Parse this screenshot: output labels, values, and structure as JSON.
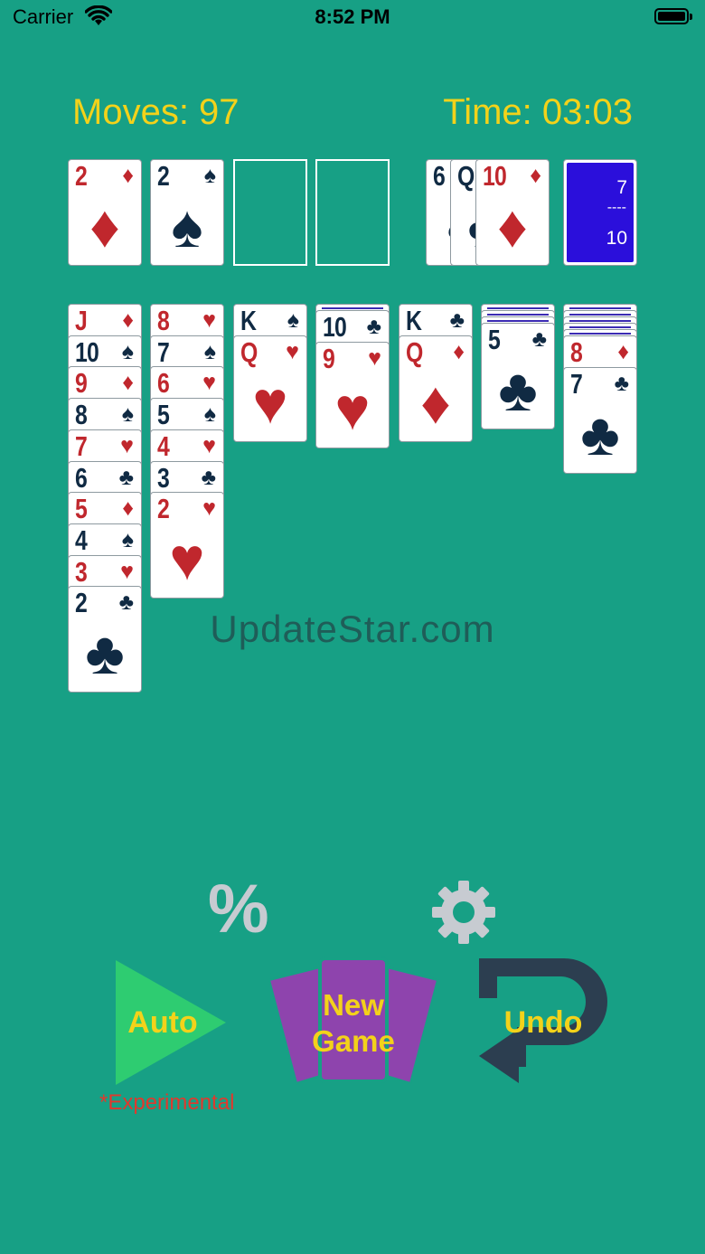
{
  "status_bar": {
    "carrier": "Carrier",
    "time": "8:52 PM"
  },
  "hud": {
    "moves": "Moves: 97",
    "time": "Time: 03:03"
  },
  "foundations": [
    {
      "rank": "2",
      "suit": "♦",
      "color": "red"
    },
    {
      "rank": "2",
      "suit": "♠",
      "color": "blk"
    },
    null,
    null
  ],
  "waste": [
    {
      "rank": "6",
      "suit": "♠",
      "color": "blk"
    },
    {
      "rank": "Q",
      "suit": "♣",
      "color": "blk"
    },
    {
      "rank": "10",
      "suit": "♦",
      "color": "red"
    }
  ],
  "stock": {
    "top": "7",
    "divider": "----",
    "bottom": "10"
  },
  "tableau": [
    {
      "hidden": 0,
      "cards": [
        {
          "rank": "J",
          "suit": "♦",
          "color": "red"
        },
        {
          "rank": "10",
          "suit": "♠",
          "color": "blk"
        },
        {
          "rank": "9",
          "suit": "♦",
          "color": "red"
        },
        {
          "rank": "8",
          "suit": "♠",
          "color": "blk"
        },
        {
          "rank": "7",
          "suit": "♥",
          "color": "red"
        },
        {
          "rank": "6",
          "suit": "♣",
          "color": "blk"
        },
        {
          "rank": "5",
          "suit": "♦",
          "color": "red"
        },
        {
          "rank": "4",
          "suit": "♠",
          "color": "blk"
        },
        {
          "rank": "3",
          "suit": "♥",
          "color": "red"
        },
        {
          "rank": "2",
          "suit": "♣",
          "color": "blk"
        }
      ]
    },
    {
      "hidden": 0,
      "cards": [
        {
          "rank": "8",
          "suit": "♥",
          "color": "red"
        },
        {
          "rank": "7",
          "suit": "♠",
          "color": "blk"
        },
        {
          "rank": "6",
          "suit": "♥",
          "color": "red"
        },
        {
          "rank": "5",
          "suit": "♠",
          "color": "blk"
        },
        {
          "rank": "4",
          "suit": "♥",
          "color": "red"
        },
        {
          "rank": "3",
          "suit": "♣",
          "color": "blk"
        },
        {
          "rank": "2",
          "suit": "♥",
          "color": "red"
        }
      ]
    },
    {
      "hidden": 0,
      "cards": [
        {
          "rank": "K",
          "suit": "♠",
          "color": "blk"
        },
        {
          "rank": "Q",
          "suit": "♥",
          "color": "red"
        }
      ]
    },
    {
      "hidden": 1,
      "cards": [
        {
          "rank": "10",
          "suit": "♣",
          "color": "blk"
        },
        {
          "rank": "9",
          "suit": "♥",
          "color": "red"
        }
      ]
    },
    {
      "hidden": 0,
      "cards": [
        {
          "rank": "K",
          "suit": "♣",
          "color": "blk"
        },
        {
          "rank": "Q",
          "suit": "♦",
          "color": "red"
        }
      ]
    },
    {
      "hidden": 3,
      "cards": [
        {
          "rank": "5",
          "suit": "♣",
          "color": "blk"
        }
      ]
    },
    {
      "hidden": 5,
      "cards": [
        {
          "rank": "8",
          "suit": "♦",
          "color": "red"
        },
        {
          "rank": "7",
          "suit": "♣",
          "color": "blk"
        }
      ]
    }
  ],
  "watermark": "UpdateStar.com",
  "controls": {
    "percent_label": "%",
    "auto_label": "Auto",
    "experimental_label": "*Experimental",
    "new_game_line1": "New",
    "new_game_line2": "Game",
    "undo_label": "Undo"
  },
  "icons": {
    "wifi": "wifi-icon",
    "battery": "battery-icon",
    "gear": "gear-icon",
    "play": "play-triangle-icon",
    "cards": "card-fan-icon",
    "undo": "undo-arrow-icon"
  },
  "colors": {
    "felt": "#17a085",
    "accent_yellow": "#f3d21a",
    "card_red": "#c0272d",
    "card_dark": "#102a43",
    "card_back": "#2b0fdb",
    "auto_green": "#2ecc71",
    "new_game_purple": "#8e44ad",
    "undo_navy": "#2c3e50",
    "experimental_red": "#e0392d"
  }
}
